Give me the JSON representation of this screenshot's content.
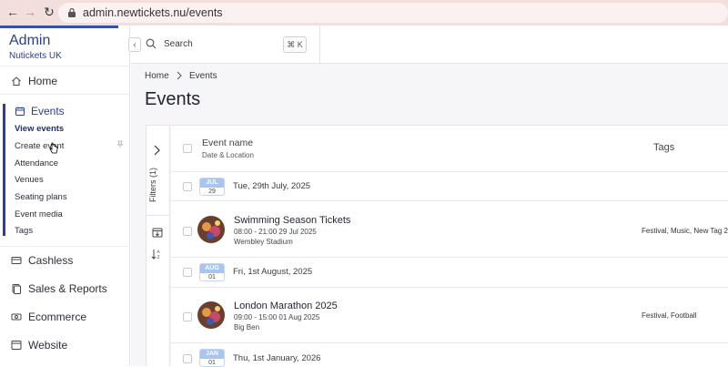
{
  "browser": {
    "url": "admin.newtickets.nu/events",
    "back_icon": "back-arrow-icon",
    "forward_icon": "forward-arrow-icon",
    "reload_icon": "reload-icon"
  },
  "sidebar": {
    "title": "Admin",
    "org": "Nutickets UK",
    "home": "Home",
    "events": {
      "label": "Events",
      "items": [
        "View events",
        "Create event",
        "Attendance",
        "Venues",
        "Seating plans",
        "Event media",
        "Tags"
      ]
    },
    "other": [
      "Cashless",
      "Sales & Reports",
      "Ecommerce",
      "Website"
    ]
  },
  "topbar": {
    "search_placeholder": "Search",
    "shortcut": "⌘ K"
  },
  "breadcrumb": [
    "Home",
    "Events"
  ],
  "page_title": "Events",
  "filters_label": "Filters (1)",
  "table": {
    "col_name": "Event name",
    "col_name_sub": "Date & Location",
    "col_tags": "Tags",
    "groups": [
      {
        "month": "JUL",
        "day": "29",
        "date_label": "Tue, 29th July, 2025",
        "event": {
          "name": "Swimming Season Tickets",
          "time": "08:00 - 21:00 29 Jul 2025",
          "venue": "Wembley Stadium",
          "tags": "Festival, Music, New Tag 2,"
        }
      },
      {
        "month": "AUG",
        "day": "01",
        "date_label": "Fri, 1st August, 2025",
        "event": {
          "name": "London Marathon 2025",
          "time": "09:00 - 15:00 01 Aug 2025",
          "venue": "Big Ben",
          "tags": "Festival, Football"
        }
      },
      {
        "month": "JAN",
        "day": "01",
        "date_label": "Thu, 1st January, 2026"
      }
    ]
  },
  "colors": {
    "brand": "#2b3f9a",
    "browser_bar": "#f3dede",
    "badge_month": "#a8c4f0"
  }
}
